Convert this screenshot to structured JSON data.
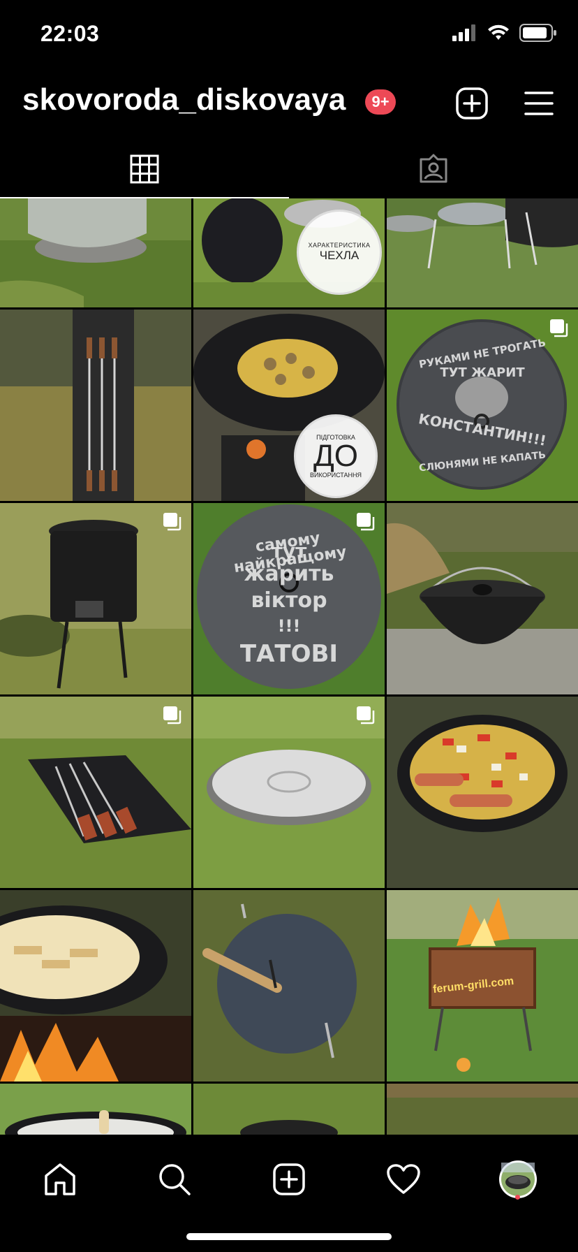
{
  "status_bar": {
    "time": "22:03"
  },
  "header": {
    "username": "skovoroda_diskovaya",
    "notification_badge": "9+"
  },
  "grid": {
    "overlays": {
      "post2_top": "ХАРАКТЕРИСТИКА",
      "post2_main": "ЧЕХЛА",
      "post5_top": "ПІДГОТОВКА",
      "post5_main": "ДО",
      "post5_bottom": "ВИКОРИСТАННЯ",
      "post6_line1": "РУКАМИ НЕ ТРОГАТЬ",
      "post6_line2": "ТУТ ЖАРИТ",
      "post6_line3": "КОНСТАНТИН!!!",
      "post6_line4": "СЛЮНЯМИ НЕ КАПАТЬ",
      "post8_line1": "самому найкращому",
      "post8_line2": "тут",
      "post8_line3": "жарить",
      "post8_line4": "віктор",
      "post8_line5": "!!!",
      "post8_line6": "ТАТОВІ",
      "post15_watermark": "ferum-grill.com"
    }
  },
  "colors": {
    "accent": "#ed4956",
    "background": "#000000",
    "text": "#ffffff"
  },
  "icons": [
    "grid-icon",
    "tagged-icon",
    "add-icon",
    "menu-icon",
    "home-icon",
    "search-icon",
    "new-post-icon",
    "heart-icon",
    "profile-avatar",
    "multi-photo-icon"
  ]
}
